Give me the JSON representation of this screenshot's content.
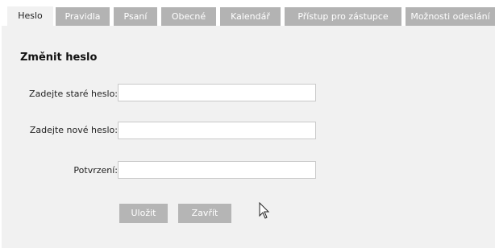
{
  "tabs": [
    {
      "label": "Heslo"
    },
    {
      "label": "Pravidla"
    },
    {
      "label": "Psaní"
    },
    {
      "label": "Obecné"
    },
    {
      "label": "Kalendář"
    },
    {
      "label": "Přístup pro zástupce"
    },
    {
      "label": "Možnosti odeslání"
    }
  ],
  "active_tab": "Heslo",
  "form": {
    "title": "Změnit heslo",
    "old_password_label": "Zadejte staré heslo:",
    "new_password_label": "Zadejte nové heslo:",
    "confirm_label": "Potvrzení:",
    "old_password_value": "",
    "new_password_value": "",
    "confirm_value": ""
  },
  "buttons": {
    "save_label": "Uložit",
    "close_label": "Zavřít"
  }
}
